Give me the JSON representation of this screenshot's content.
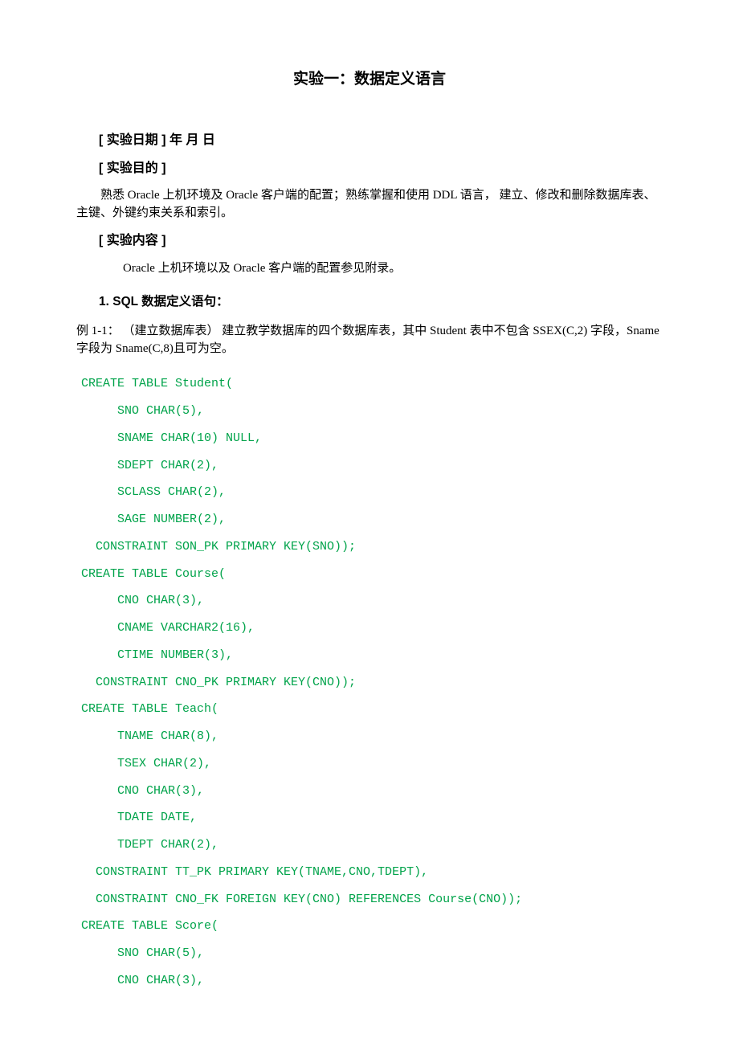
{
  "title": "实验一：数据定义语言",
  "date": {
    "label": "[ 实验日期 ]",
    "spacer": "            ",
    "year": "年",
    "month": "    月",
    "day": "    日"
  },
  "purpose": {
    "label": "[ 实验目的 ]",
    "text": "熟悉 Oracle 上机环境及 Oracle 客户端的配置；熟练掌握和使用 DDL 语言， 建立、修改和删除数据库表、主键、外键约束关系和索引。"
  },
  "content": {
    "label": "[ 实验内容 ]",
    "intro": "Oracle 上机环境以及 Oracle 客户端的配置参见附录。"
  },
  "section1": {
    "heading": "1.   SQL 数据定义语句：",
    "example": "例 1-1：  （建立数据库表）  建立教学数据库的四个数据库表，其中 Student 表中不包含 SSEX(C,2) 字段，Sname 字段为 Sname(C,8)且可为空。"
  },
  "code": "CREATE TABLE Student(\n     SNO CHAR(5),\n     SNAME CHAR(10) NULL,\n     SDEPT CHAR(2),\n     SCLASS CHAR(2),\n     SAGE NUMBER(2),\n  CONSTRAINT SON_PK PRIMARY KEY(SNO));\nCREATE TABLE Course(\n     CNO CHAR(3),\n     CNAME VARCHAR2(16),\n     CTIME NUMBER(3),\n  CONSTRAINT CNO_PK PRIMARY KEY(CNO));\nCREATE TABLE Teach(\n     TNAME CHAR(8),\n     TSEX CHAR(2),\n     CNO CHAR(3),\n     TDATE DATE,\n     TDEPT CHAR(2),\n  CONSTRAINT TT_PK PRIMARY KEY(TNAME,CNO,TDEPT),\n  CONSTRAINT CNO_FK FOREIGN KEY(CNO) REFERENCES Course(CNO));\nCREATE TABLE Score(\n     SNO CHAR(5),\n     CNO CHAR(3),"
}
